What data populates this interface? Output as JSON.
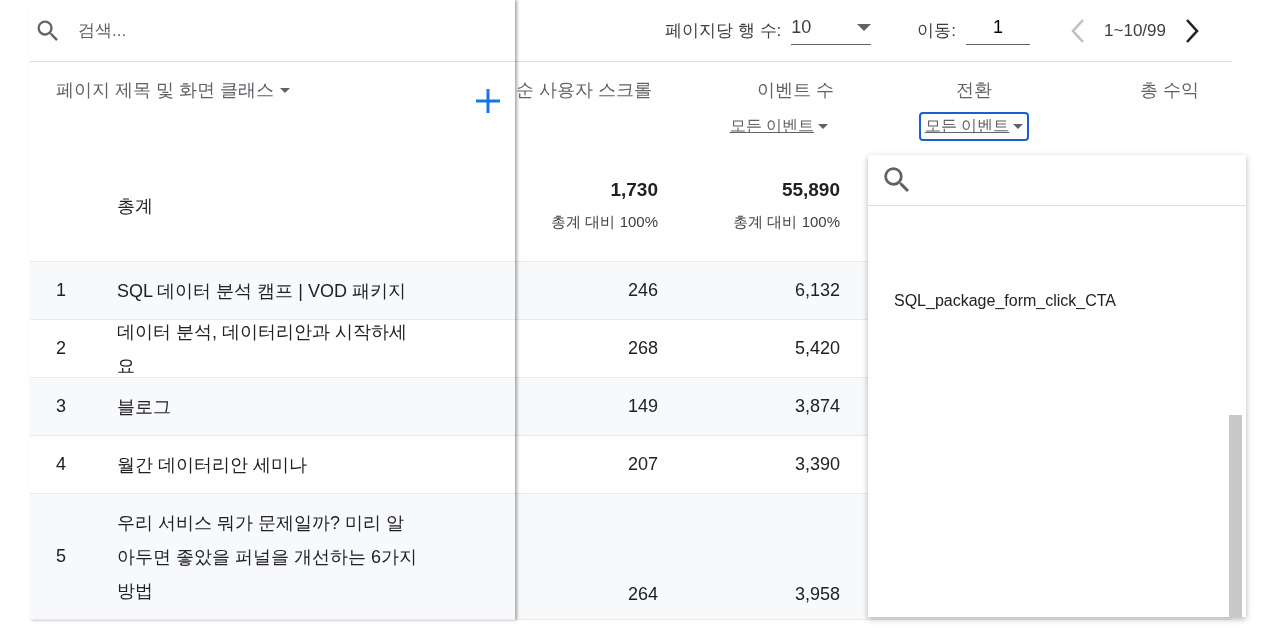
{
  "search": {
    "placeholder": "검색..."
  },
  "pagination": {
    "rows_label": "페이지당 행 수:",
    "rows_value": "10",
    "goto_label": "이동:",
    "goto_value": "1",
    "range": "1~10/99",
    "prev_disabled": true,
    "next_disabled": false
  },
  "dimension_header": "페이지 제목 및 화면 클래스",
  "columns": [
    {
      "label": "순 사용자 스크롤"
    },
    {
      "label": "이벤트 수",
      "filter": {
        "label": "모든 이벤트",
        "focused": false
      }
    },
    {
      "label": "전환",
      "filter": {
        "label": "모든 이벤트",
        "focused": true
      }
    },
    {
      "label": "총 수익"
    }
  ],
  "totals": {
    "label": "총계",
    "values": [
      {
        "value": "1,730",
        "share": "총계 대비 100%"
      },
      {
        "value": "55,890",
        "share": "총계 대비 100%"
      }
    ]
  },
  "rows": [
    {
      "index": "1",
      "title": "SQL 데이터 분석 캠프 | VOD 패키지",
      "values": [
        "246",
        "6,132"
      ]
    },
    {
      "index": "2",
      "title": "데이터 분석, 데이터리안과 시작하세요",
      "values": [
        "268",
        "5,420"
      ]
    },
    {
      "index": "3",
      "title": "블로그",
      "values": [
        "149",
        "3,874"
      ]
    },
    {
      "index": "4",
      "title": "월간 데이터리안 세미나",
      "values": [
        "207",
        "3,390"
      ]
    },
    {
      "index": "5",
      "title": "우리 서비스 뭐가 문제일까? 미리 알아두면 좋았을 퍼널을 개선하는 6가지 방법",
      "values": [
        "264",
        "3,958"
      ]
    }
  ],
  "dropdown": {
    "items": [
      "SQL_package_form_click_CTA"
    ]
  }
}
